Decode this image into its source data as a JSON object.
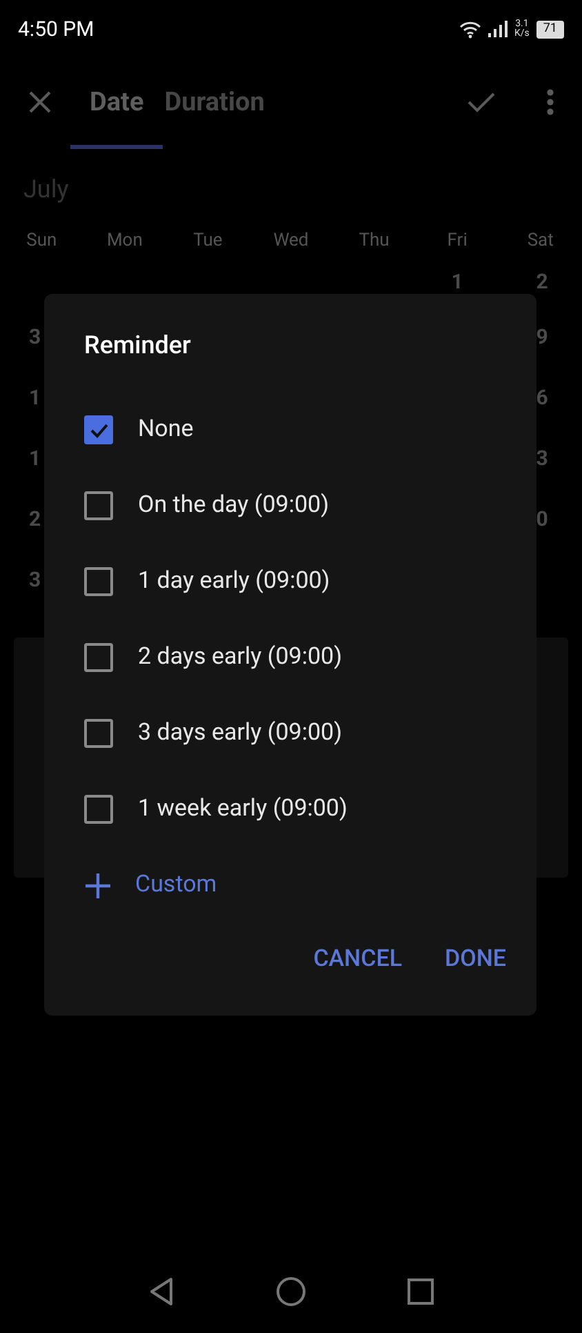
{
  "status_bar": {
    "time": "4:50 PM",
    "speed_value": "3.1",
    "speed_unit": "K/s",
    "battery": "71"
  },
  "toolbar": {
    "tabs": [
      {
        "label": "Date",
        "selected": true
      },
      {
        "label": "Duration",
        "selected": false
      }
    ]
  },
  "calendar": {
    "month": "July",
    "weekdays": [
      "Sun",
      "Mon",
      "Tue",
      "Wed",
      "Thu",
      "Fri",
      "Sat"
    ],
    "weeks": [
      {
        "fri": "1",
        "sat": "2"
      },
      {
        "sun": "3",
        "sat": "9"
      },
      {
        "sun": "1",
        "sat": "6"
      },
      {
        "sun": "1",
        "sat": "3"
      },
      {
        "sun": "2",
        "sat": "0"
      },
      {
        "sun": "3"
      }
    ]
  },
  "dialog": {
    "title": "Reminder",
    "options": [
      {
        "label": "None",
        "checked": true
      },
      {
        "label": "On the day (09:00)",
        "checked": false
      },
      {
        "label": "1 day early (09:00)",
        "checked": false
      },
      {
        "label": "2 days early (09:00)",
        "checked": false
      },
      {
        "label": "3 days early (09:00)",
        "checked": false
      },
      {
        "label": "1 week early (09:00)",
        "checked": false
      }
    ],
    "custom": "Custom",
    "buttons": [
      "CANCEL",
      "DONE"
    ]
  }
}
